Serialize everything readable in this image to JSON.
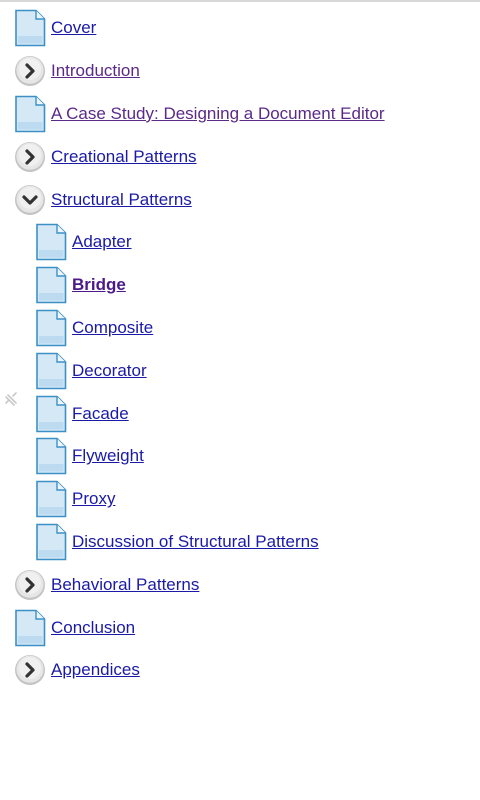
{
  "toc": {
    "items": [
      {
        "label": "Cover",
        "icon": "page-icon",
        "level": 0,
        "state": "link"
      },
      {
        "label": "Introduction",
        "icon": "expand-arrow-icon",
        "level": 0,
        "state": "visited"
      },
      {
        "label": "A Case Study: Designing a Document Editor",
        "icon": "page-icon",
        "level": 0,
        "state": "visited"
      },
      {
        "label": "Creational Patterns",
        "icon": "expand-arrow-icon",
        "level": 0,
        "state": "link"
      },
      {
        "label": "Structural Patterns",
        "icon": "collapse-arrow-icon",
        "level": 0,
        "state": "link"
      },
      {
        "label": "Adapter",
        "icon": "page-icon",
        "level": 1,
        "state": "link"
      },
      {
        "label": "Bridge",
        "icon": "page-icon",
        "level": 1,
        "state": "current"
      },
      {
        "label": "Composite",
        "icon": "page-icon",
        "level": 1,
        "state": "link"
      },
      {
        "label": "Decorator",
        "icon": "page-icon",
        "level": 1,
        "state": "link"
      },
      {
        "label": "Facade",
        "icon": "page-icon",
        "level": 1,
        "state": "link"
      },
      {
        "label": "Flyweight",
        "icon": "page-icon",
        "level": 1,
        "state": "link"
      },
      {
        "label": "Proxy",
        "icon": "page-icon",
        "level": 1,
        "state": "link"
      },
      {
        "label": "Discussion of Structural Patterns",
        "icon": "page-icon",
        "level": 1,
        "state": "link"
      },
      {
        "label": "Behavioral Patterns",
        "icon": "expand-arrow-icon",
        "level": 0,
        "state": "link"
      },
      {
        "label": "Conclusion",
        "icon": "page-icon",
        "level": 0,
        "state": "link"
      },
      {
        "label": "Appendices",
        "icon": "expand-arrow-icon",
        "level": 0,
        "state": "link"
      }
    ]
  },
  "colors": {
    "link": "#1a1aa6",
    "visited": "#5a2a88",
    "current": "#4b1a88",
    "page_icon_fill": "#cfe5f5",
    "page_icon_stroke": "#3c8fc4"
  },
  "side_handle_icon": "drag-handle-icon"
}
